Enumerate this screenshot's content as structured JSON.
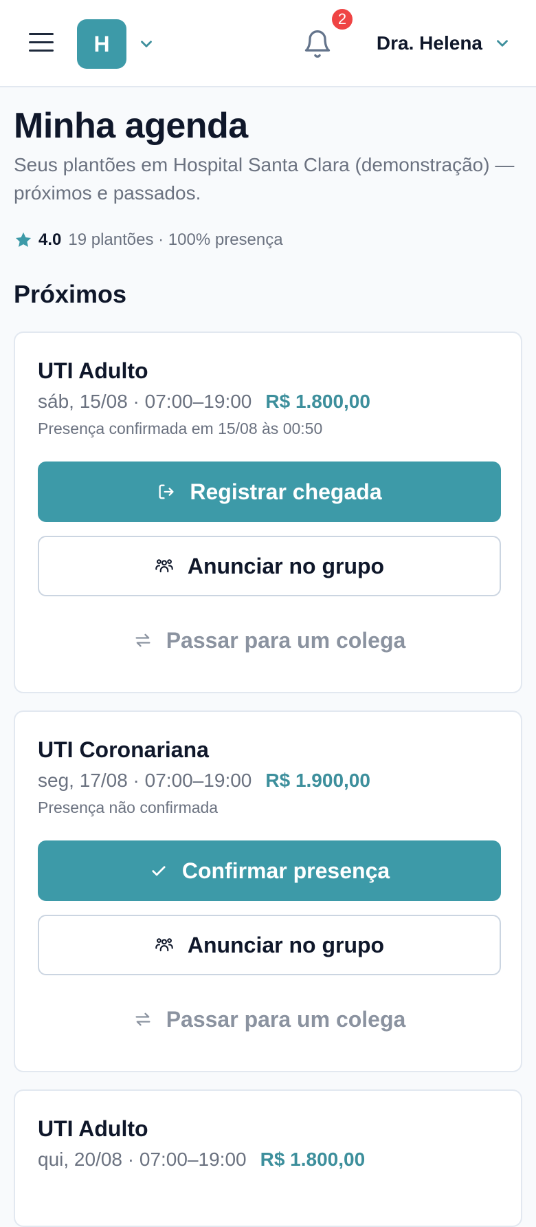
{
  "header": {
    "org_initial": "H",
    "notification_count": "2",
    "user_name": "Dra. Helena"
  },
  "page": {
    "title": "Minha agenda",
    "subtitle": "Seus plantões em Hospital Santa Clara (demonstração) — próximos e passados.",
    "rating_score": "4.0",
    "rating_stats": "19 plantões · 100% presença",
    "section_upcoming": "Próximos"
  },
  "shifts": [
    {
      "title": "UTI Adulto",
      "time": "sáb, 15/08 · 07:00–19:00",
      "price": "R$ 1.800,00",
      "status": "Presença confirmada em 15/08 às 00:50",
      "primary_action": "Registrar chegada",
      "primary_icon": "check-in-icon",
      "announce_action": "Anunciar no grupo",
      "pass_action": "Passar para um colega"
    },
    {
      "title": "UTI Coronariana",
      "time": "seg, 17/08 · 07:00–19:00",
      "price": "R$ 1.900,00",
      "status": "Presença não confirmada",
      "primary_action": "Confirmar presença",
      "primary_icon": "check-icon",
      "announce_action": "Anunciar no grupo",
      "pass_action": "Passar para um colega"
    },
    {
      "title": "UTI Adulto",
      "time": "qui, 20/08 · 07:00–19:00",
      "price": "R$ 1.800,00"
    }
  ],
  "colors": {
    "accent": "#3d9aa8",
    "price": "#3d8f9c",
    "badge": "#ef4444",
    "star": "#3d9aa8"
  }
}
